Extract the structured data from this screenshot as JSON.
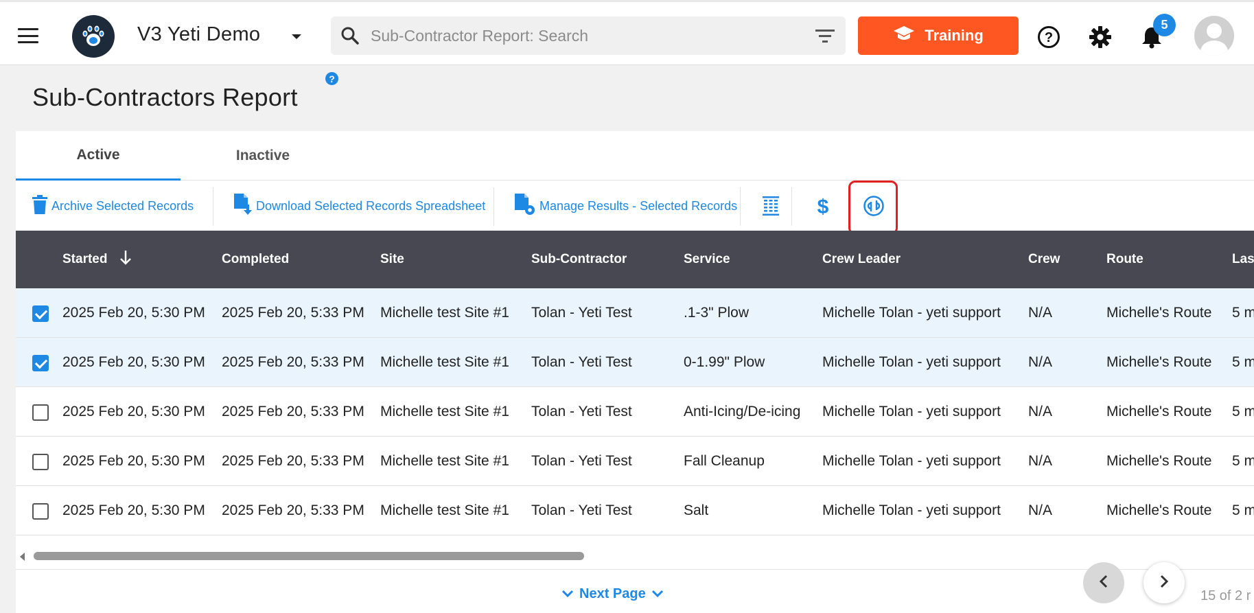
{
  "header": {
    "app_title": "V3 Yeti Demo",
    "search_placeholder": "Sub-Contractor Report: Search",
    "training_label": "Training",
    "notification_count": "5",
    "accent_color": "#ff5722"
  },
  "page": {
    "title": "Sub-Contractors Report",
    "help_glyph": "?"
  },
  "tabs": [
    {
      "label": "Active",
      "active": true
    },
    {
      "label": "Inactive",
      "active": false
    }
  ],
  "toolbar": {
    "archive_label": "Archive Selected Records",
    "download_label": "Download Selected Records Spreadsheet",
    "manage_label": "Manage Results - Selected Records",
    "icons": [
      "columns-icon",
      "dollar-icon",
      "quickbooks-icon"
    ]
  },
  "table": {
    "columns": [
      "Started",
      "Completed",
      "Site",
      "Sub-Contractor",
      "Service",
      "Crew Leader",
      "Crew",
      "Route",
      "Last"
    ],
    "sort_column": "Started",
    "sort_direction": "descending",
    "rows": [
      {
        "selected": true,
        "cells": [
          "2025 Feb 20, 5:30 PM",
          "2025 Feb 20, 5:33 PM",
          "Michelle test Site #1",
          "Tolan - Yeti Test",
          ".1-3\" Plow",
          "Michelle Tolan - yeti support",
          "N/A",
          "Michelle's Route",
          "5 m"
        ]
      },
      {
        "selected": true,
        "cells": [
          "2025 Feb 20, 5:30 PM",
          "2025 Feb 20, 5:33 PM",
          "Michelle test Site #1",
          "Tolan - Yeti Test",
          "0-1.99\" Plow",
          "Michelle Tolan - yeti support",
          "N/A",
          "Michelle's Route",
          "5 m"
        ]
      },
      {
        "selected": false,
        "cells": [
          "2025 Feb 20, 5:30 PM",
          "2025 Feb 20, 5:33 PM",
          "Michelle test Site #1",
          "Tolan - Yeti Test",
          "Anti-Icing/De-icing",
          "Michelle Tolan - yeti support",
          "N/A",
          "Michelle's Route",
          "5 m"
        ]
      },
      {
        "selected": false,
        "cells": [
          "2025 Feb 20, 5:30 PM",
          "2025 Feb 20, 5:33 PM",
          "Michelle test Site #1",
          "Tolan - Yeti Test",
          "Fall Cleanup",
          "Michelle Tolan - yeti support",
          "N/A",
          "Michelle's Route",
          "5 m"
        ]
      },
      {
        "selected": false,
        "cells": [
          "2025 Feb 20, 5:30 PM",
          "2025 Feb 20, 5:33 PM",
          "Michelle test Site #1",
          "Tolan - Yeti Test",
          "Salt",
          "Michelle Tolan - yeti support",
          "N/A",
          "Michelle's Route",
          "5 m"
        ]
      }
    ]
  },
  "footer": {
    "next_page_label": "Next Page",
    "page_count": "15 of 2 r"
  }
}
